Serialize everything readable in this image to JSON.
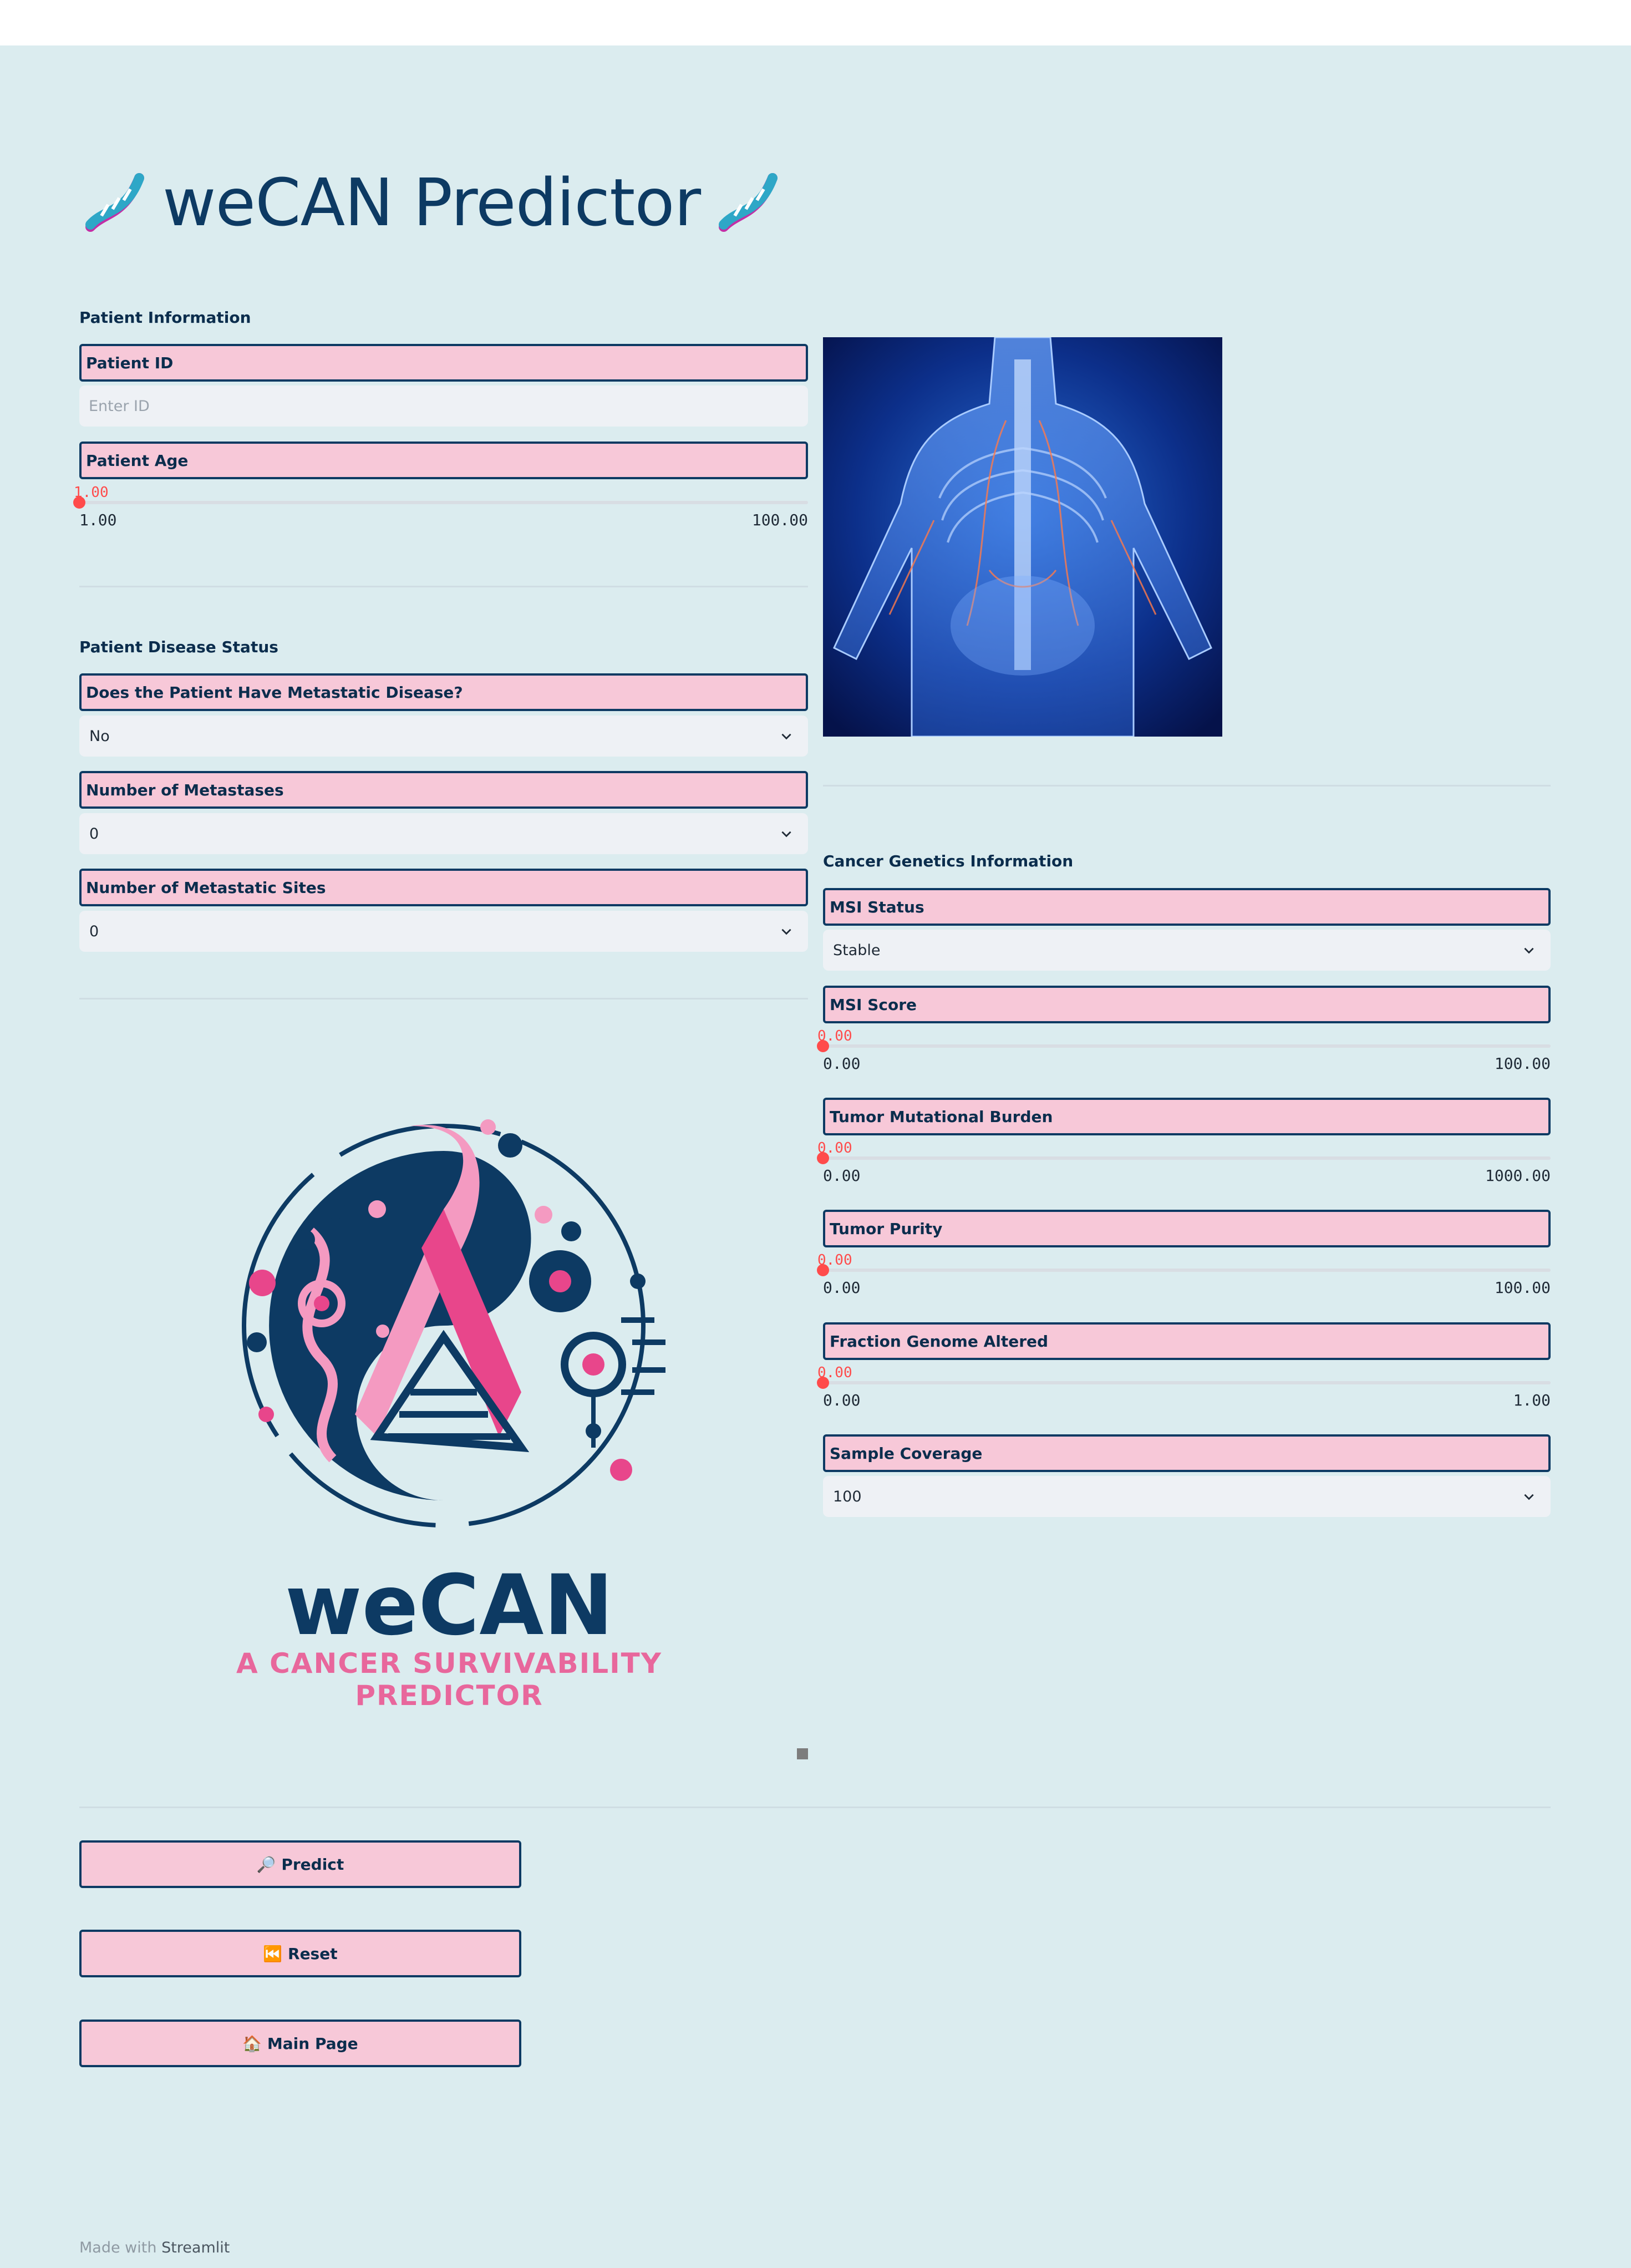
{
  "app": {
    "title": "weCAN Predictor",
    "title_icon": "dna-icon",
    "accent_color": "#f7c8d8",
    "border_color": "#0d3a63",
    "slider_color": "#ff4b4b",
    "background": "#dbecef"
  },
  "patient_info": {
    "heading": "Patient Information",
    "id_label": "Patient ID",
    "id_placeholder": "Enter ID",
    "age_label": "Patient Age",
    "age_value": "1.00",
    "age_min": "1.00",
    "age_max": "100.00",
    "age_fraction": 0
  },
  "disease_status": {
    "heading": "Patient Disease Status",
    "metastatic_label": "Does the Patient Have Metastatic Disease?",
    "metastatic_value": "No",
    "num_metastases_label": "Number of Metastases",
    "num_metastases_value": "0",
    "num_sites_label": "Number of Metastatic Sites",
    "num_sites_value": "0"
  },
  "genetics": {
    "heading": "Cancer Genetics Information",
    "msi_status_label": "MSI Status",
    "msi_status_value": "Stable",
    "msi_score": {
      "label": "MSI Score",
      "value": "0.00",
      "min": "0.00",
      "max": "100.00",
      "fraction": 0
    },
    "tmb": {
      "label": "Tumor Mutational Burden",
      "value": "0.00",
      "min": "0.00",
      "max": "1000.00",
      "fraction": 0
    },
    "purity": {
      "label": "Tumor Purity",
      "value": "0.00",
      "min": "0.00",
      "max": "100.00",
      "fraction": 0
    },
    "fga": {
      "label": "Fraction Genome Altered",
      "value": "0.00",
      "min": "0.00",
      "max": "1.00",
      "fraction": 0
    },
    "coverage_label": "Sample Coverage",
    "coverage_value": "100"
  },
  "logo": {
    "name": "weCAN",
    "tagline": "A CANCER SURVIVABILITY PREDICTOR"
  },
  "buttons": {
    "predict": "🔎 Predict",
    "reset": "⏮️ Reset",
    "main_page": "🏠 Main Page"
  },
  "footer": {
    "prefix": "Made with",
    "brand": "Streamlit"
  }
}
